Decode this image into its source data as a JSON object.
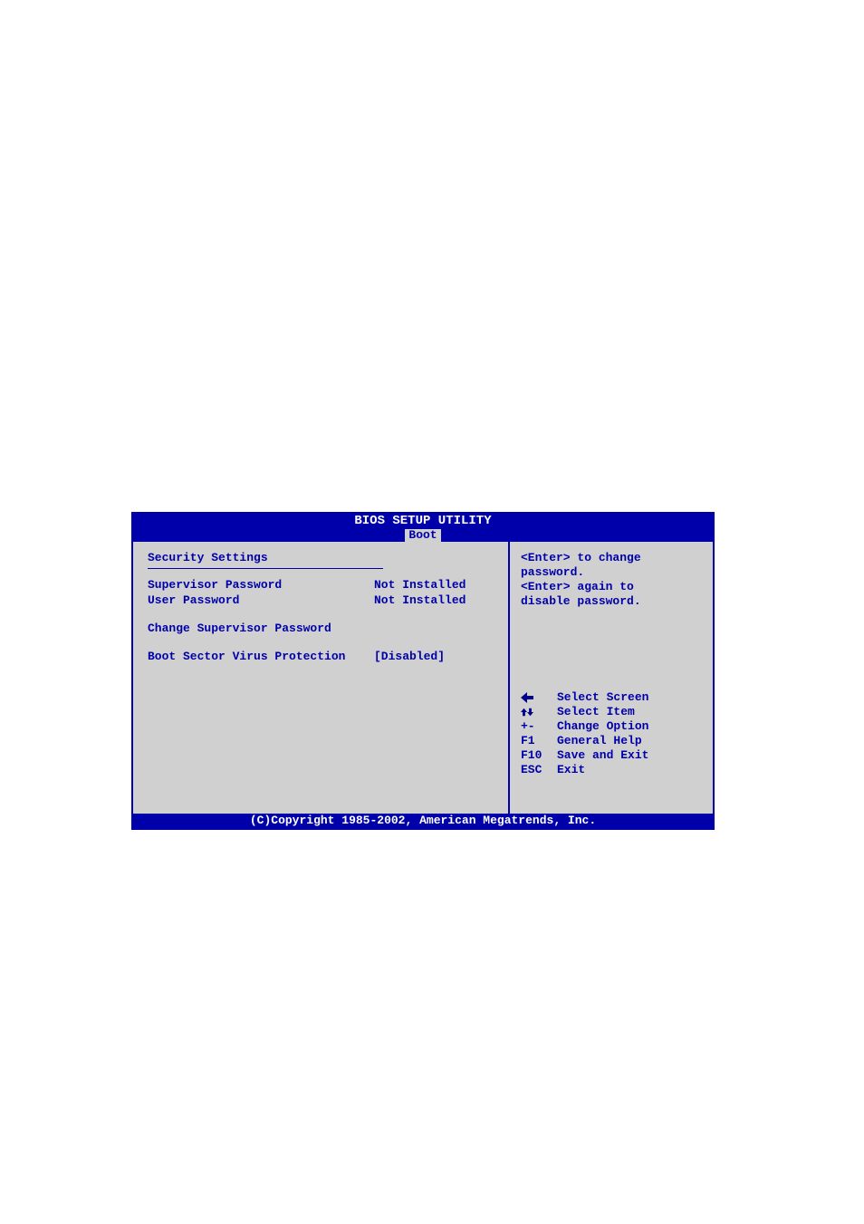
{
  "title": "BIOS SETUP UTILITY",
  "active_tab": "Boot",
  "main": {
    "heading": "Security Settings",
    "status_items": [
      {
        "label": "Supervisor Password",
        "value": "Not Installed"
      },
      {
        "label": "User Password",
        "value": "Not Installed"
      }
    ],
    "action_items": [
      {
        "label": "Change Supervisor Password"
      }
    ],
    "option_items": [
      {
        "label": "Boot Sector Virus Protection",
        "value": "[Disabled]"
      }
    ]
  },
  "help": {
    "text_lines": [
      "<Enter> to change",
      "password.",
      "<Enter> again to",
      "disable password."
    ],
    "nav": [
      {
        "key_icon": "arrow-left",
        "key": "",
        "desc": "Select Screen"
      },
      {
        "key_icon": "arrows-updown",
        "key": "",
        "desc": "Select Item"
      },
      {
        "key_icon": "",
        "key": "+-",
        "desc": "Change Option"
      },
      {
        "key_icon": "",
        "key": "F1",
        "desc": "General Help"
      },
      {
        "key_icon": "",
        "key": "F10",
        "desc": "Save and Exit"
      },
      {
        "key_icon": "",
        "key": "ESC",
        "desc": "Exit"
      }
    ]
  },
  "footer": "(C)Copyright 1985-2002, American Megatrends, Inc."
}
